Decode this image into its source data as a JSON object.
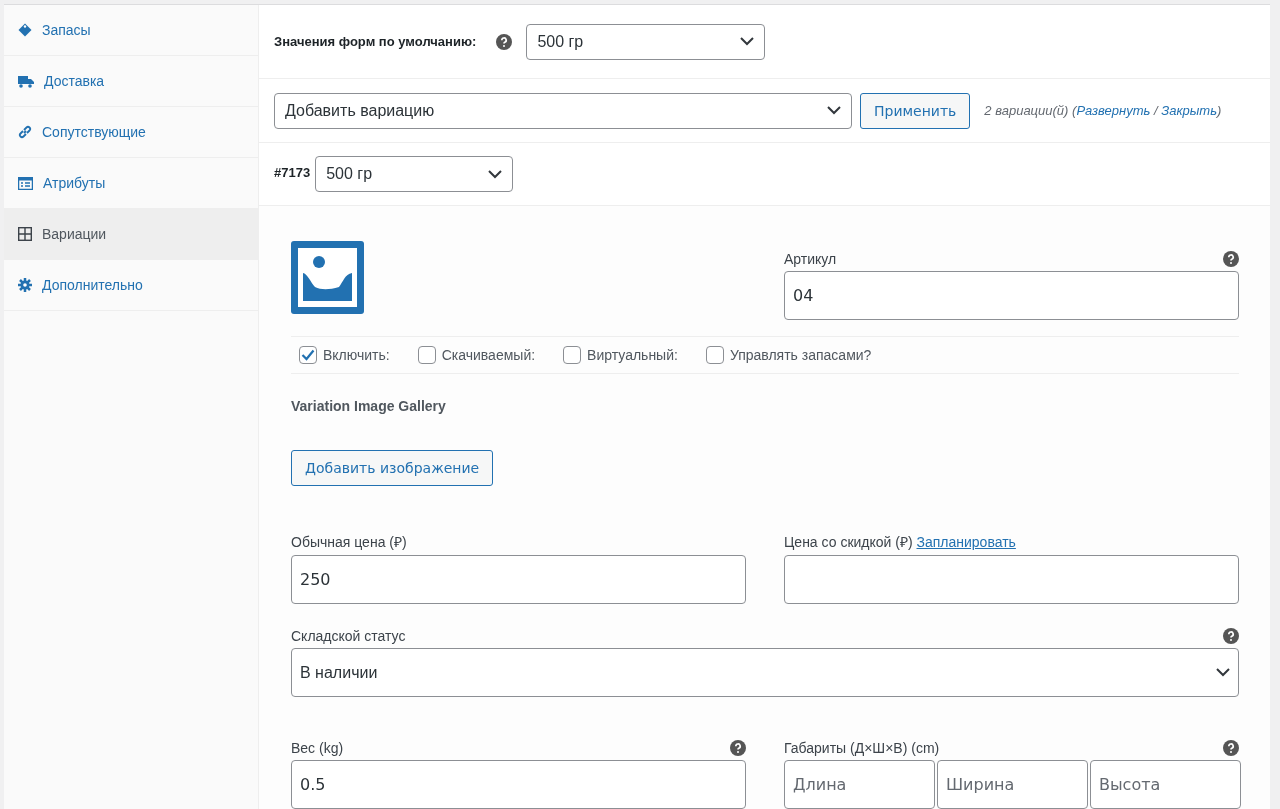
{
  "sidebar": {
    "items": [
      {
        "label": "Запасы",
        "kind": "tag",
        "selected": false
      },
      {
        "label": "Доставка",
        "kind": "truck",
        "selected": false
      },
      {
        "label": "Сопутствующие",
        "kind": "link",
        "selected": false
      },
      {
        "label": "Атрибуты",
        "kind": "card",
        "selected": false
      },
      {
        "label": "Вариации",
        "kind": "grid",
        "selected": true
      },
      {
        "label": "Дополнительно",
        "kind": "gear",
        "selected": false
      }
    ]
  },
  "defaults": {
    "label": "Значения форм по умолчанию:",
    "value": "500 гр"
  },
  "bulk": {
    "value": "Добавить вариацию",
    "button": "Применить",
    "count": "2 вариации(й)",
    "open_paren": "(",
    "expand": "Развернуть",
    "separator": "/",
    "collapse": "Закрыть",
    "close_paren": ")"
  },
  "variation": {
    "id": "#7173",
    "value": "500 гр",
    "sku": {
      "label": "Артикул",
      "value": "04"
    },
    "options": [
      {
        "label": "Включить:",
        "checked": true
      },
      {
        "label": "Скачиваемый:",
        "checked": false
      },
      {
        "label": "Виртуальный:",
        "checked": false
      },
      {
        "label": "Управлять запасами?",
        "checked": false
      }
    ],
    "gallery": {
      "title": "Variation Image Gallery",
      "button": "Добавить изображение"
    },
    "regular_price": {
      "label": "Обычная цена (₽)",
      "value": "250"
    },
    "sale_price": {
      "label": "Цена со скидкой (₽)",
      "link": "Запланировать"
    },
    "stock_status": {
      "label": "Складской статус",
      "value": "В наличии"
    },
    "weight": {
      "label": "Вес (kg)",
      "value": "0.5"
    },
    "dimensions": {
      "label": "Габариты (Д×Ш×В) (cm)",
      "fields": [
        {
          "placeholder": "Длина"
        },
        {
          "placeholder": "Ширина"
        },
        {
          "placeholder": "Высота"
        }
      ]
    }
  }
}
